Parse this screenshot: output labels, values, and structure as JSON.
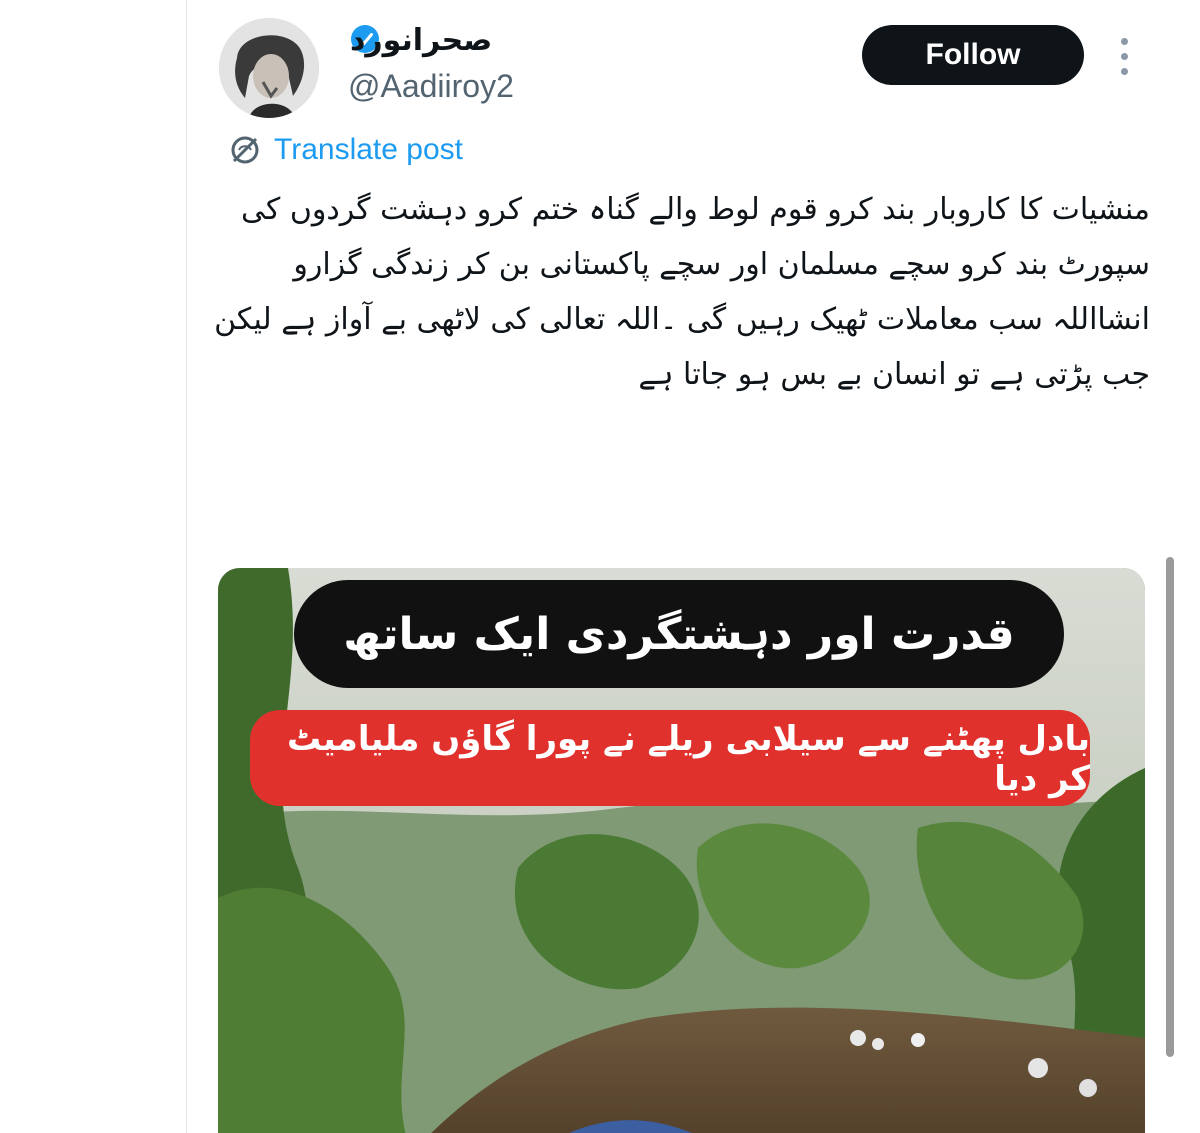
{
  "tweet": {
    "display_name": "صحرانورد",
    "handle": "@Aadiiroy2",
    "verified_icon": "verified-badge-icon",
    "follow_label": "Follow",
    "more_icon": "more-vertical-icon",
    "translate_icon": "translate-globe-icon",
    "translate_label": "Translate post",
    "text": "منشیات کا کاروبار بند کرو قوم لوط والے گناہ ختم کرو دہشت گردوں کی سپورٹ بند کرو سچے مسلمان اور سچے پاکستانی بن کر زندگی گزارو انشااللہ سب معاملات ٹھیک رہیں گی ۔اللہ تعالی کی لاٹھی بے آواز ہے لیکن جب پڑتی ہے تو انسان بے بس ہو جاتا ہے"
  },
  "media": {
    "banner_top": "قدرت اور دہشتگردی ایک ساتھ",
    "banner_bottom": "بادل پھٹنے سے سیلابی ریلے نے پورا گاؤں ملیامیٹ کر دیا"
  },
  "colors": {
    "accent": "#1d9bf0",
    "text": "#0f1419",
    "secondary": "#536471",
    "follow_bg": "#0f1419",
    "banner_red": "#e0312d"
  }
}
